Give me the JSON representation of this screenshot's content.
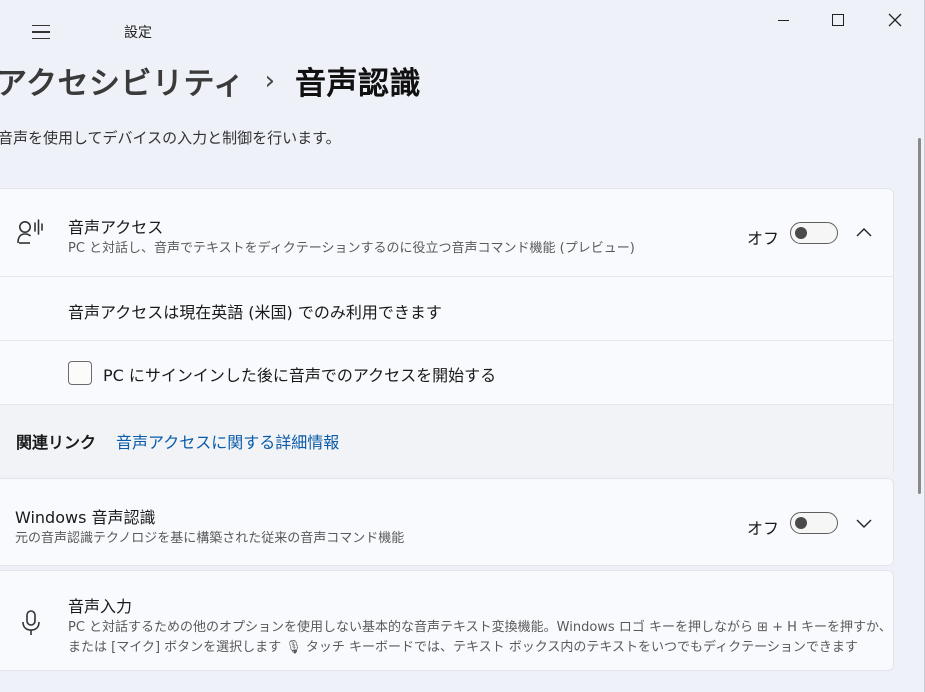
{
  "window": {
    "app_title": "設定"
  },
  "breadcrumb": {
    "parent": "アクセシビリティ",
    "separator": "›",
    "current": "音声認識"
  },
  "page_description": "音声を使用してデバイスの入力と制御を行います。",
  "voice_access": {
    "title": "音声アクセス",
    "description": "PC と対話し、音声でテキストをディクテーションするのに役立つ音声コマンド機能 (プレビュー)",
    "toggle_label": "オフ",
    "toggle_on": false,
    "icon": "voice-access-icon",
    "expanded": true,
    "note": "音声アクセスは現在英語 (米国) でのみ利用できます",
    "checkbox_label": "PC にサインインした後に音声でのアクセスを開始する",
    "checkbox_checked": false,
    "related_label": "関連リンク",
    "related_link": "音声アクセスに関する詳細情報"
  },
  "windows_speech": {
    "title": "Windows 音声認識",
    "description": "元の音声認識テクノロジを基に構築された従来の音声コマンド機能",
    "toggle_label": "オフ",
    "toggle_on": false
  },
  "voice_typing": {
    "title": "音声入力",
    "description_line1": "PC と対話するための他のオプションを使用しない基本的な音声テキスト変換機能。Windows ロゴ キーを押しながら ⊞ + H キーを押すか、",
    "description_line2": "または [マイク] ボタンを選択します 🎙 タッチ キーボードでは、テキスト ボックス内のテキストをいつでもディクテーションできます",
    "icon": "microphone-icon"
  }
}
